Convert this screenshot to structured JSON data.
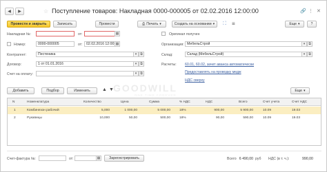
{
  "title": "Поступление товаров: Накладная 0000-000005 от 02.02.2016 12:00:00",
  "toolbar": {
    "post_and_close": "Провести и закрыть",
    "save": "Записать",
    "post": "Провести",
    "print": "Печать",
    "create_based_on": "Создать на основании",
    "more": "Еще",
    "help": "?"
  },
  "form": {
    "invoice_label": "Накладная №:",
    "from_label": "от:",
    "number_label": "Номер:",
    "number_value": "0000-000005",
    "date_value": "02.02.2016 12:00:00",
    "original_received_label": "Оригинал получен",
    "organization_label": "Организация:",
    "organization_value": "МебельСтрой",
    "counterparty_label": "Контрагент:",
    "counterparty_value": "Пестеника",
    "warehouse_label": "Склад:",
    "warehouse_value": "Склад (МебельСтрой)",
    "contract_label": "Договор:",
    "contract_value": "1 от 01.01.2016",
    "settlements_label": "Расчеты:",
    "settlements_link": "60.01, 60.02, зачет аванса автоматически",
    "payment_account_label": "Счет на оплату:",
    "payment_account_link": "Предоставлять на проводку медж",
    "vat_link": "НДС сверху"
  },
  "table_toolbar": {
    "add": "Добавить",
    "select": "Подбор",
    "change": "Изменить",
    "more": "Еще"
  },
  "table": {
    "columns": [
      "N",
      "Номенклатура",
      "Количество",
      "Цена",
      "Сумма",
      "% НДС",
      "НДС",
      "Всего",
      "Счет учета",
      "Счет НДС"
    ],
    "rows": [
      [
        "1",
        "Комбинезон рабочий",
        "5,000",
        "1 000,00",
        "5 000,00",
        "18%",
        "900,00",
        "5 900,00",
        "10.09",
        "19.03"
      ],
      [
        "2",
        "Рукавицы",
        "10,000",
        "50,00",
        "500,00",
        "18%",
        "90,00",
        "590,00",
        "10.09",
        "19.03"
      ]
    ]
  },
  "footer": {
    "invoice_label": "Счет-фактура №:",
    "from_label": "от:",
    "register_button": "Зарегистрировать",
    "total_label": "Всего",
    "total_value": "6 490,00",
    "currency": "руб",
    "vat_label": "НДС (в т. ч.):",
    "vat_value": "990,00"
  },
  "watermark": "GOODWILL",
  "watermark_sub": "ONE TIME FOREVER"
}
